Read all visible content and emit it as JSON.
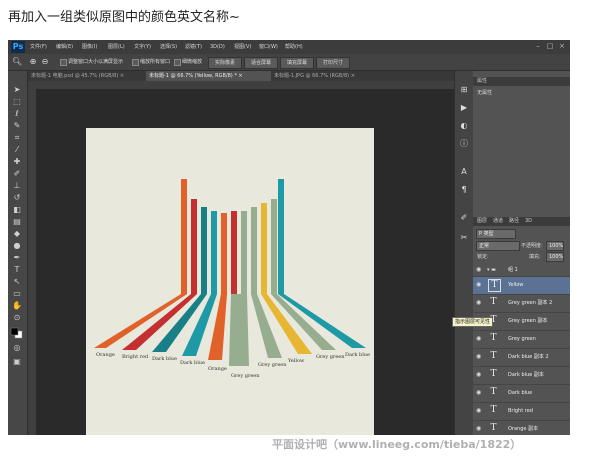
{
  "caption": "再加入一组类似原图中的颜色英文名称~",
  "app": {
    "logo": "Ps",
    "menu": [
      "文件(F)",
      "编辑(E)",
      "图像(I)",
      "图层(L)",
      "文字(Y)",
      "选择(S)",
      "滤镜(T)",
      "3D(D)",
      "视图(V)",
      "窗口(W)",
      "帮助(H)"
    ],
    "options_bar": {
      "checkbox_1": "调整窗口大小以满屏显示",
      "checkbox_2": "缩放所有窗口",
      "checkbox_3": "细微缩放",
      "btn_actual_pixels": "实际像素",
      "btn_fit_screen": "适合屏幕",
      "btn_fill_screen": "填充屏幕",
      "btn_print_size": "打印尺寸"
    },
    "doc_tabs": [
      "未标题-1 电脑.psd @ 45.7% (RGB/8) ×",
      "未标题-1 @ 66.7% (Yellow, RGB/8) * ×",
      "未标题-1.JPG @ 66.7% (RGB/8) ×"
    ]
  },
  "properties_panel": {
    "title": "属性",
    "status": "无属性"
  },
  "layers_panel": {
    "tabs": [
      "图层",
      "通道",
      "路径",
      "3D"
    ],
    "kind_label": "P 类型",
    "blend_mode": "正常",
    "opacity_label": "不透明度:",
    "opacity_value": "100%",
    "lock_label": "锁定:",
    "fill_label": "填充:",
    "fill_value": "100%",
    "group_name": "组 1",
    "layers": [
      {
        "name": "Yellow",
        "selected": true
      },
      {
        "name": "Grey green 副本 2",
        "selected": false
      },
      {
        "name": "Grey green 副本",
        "selected": false
      },
      {
        "name": "Grey green",
        "selected": false
      },
      {
        "name": "Dark blue 副本 2",
        "selected": false
      },
      {
        "name": "Dark blue 副本",
        "selected": false
      },
      {
        "name": "Dark blue",
        "selected": false
      },
      {
        "name": "Bright red",
        "selected": false
      },
      {
        "name": "Orange 副本",
        "selected": false
      },
      {
        "name": "Orange",
        "selected": false
      }
    ]
  },
  "tooltip": "指示图层可见性",
  "watermark": "平面设计吧（www.lineeg.com/tieba/1822）",
  "artwork": {
    "colors": {
      "orange": "#e0622a",
      "bright_red": "#c42f2f",
      "dark_blue": "#197f86",
      "grey_green": "#97ad8f",
      "yellow": "#e7b733",
      "teal": "#1e99a6"
    },
    "labels": [
      "Orange",
      "Bright red",
      "Dark blue",
      "Dark blue",
      "Orange",
      "Grey green",
      "Grey green",
      "Yellow",
      "Grey green",
      "Dark blue"
    ]
  }
}
